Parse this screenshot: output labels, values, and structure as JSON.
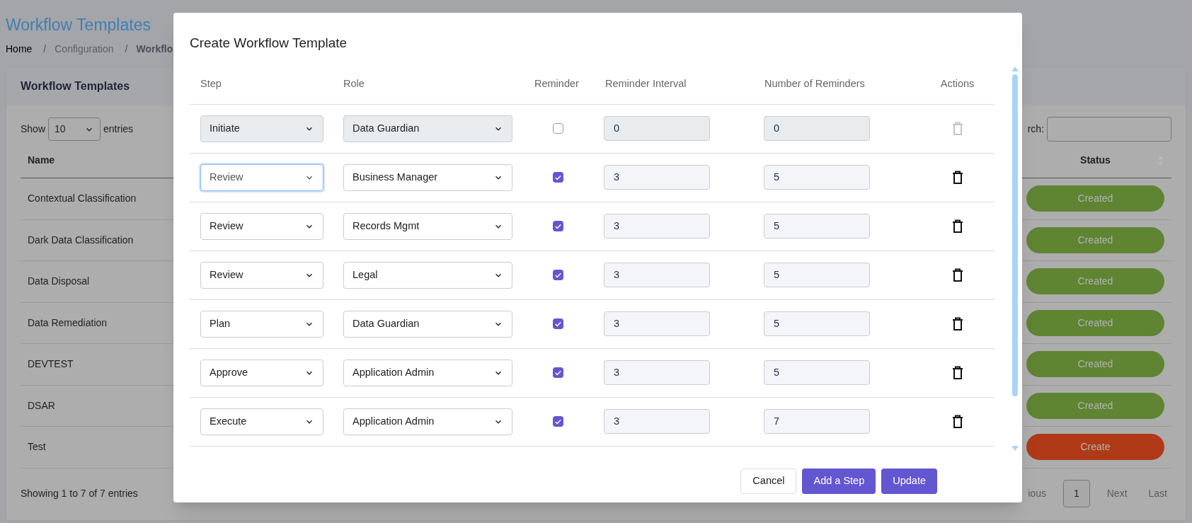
{
  "page": {
    "title": "Workflow Templates",
    "breadcrumb": [
      {
        "label": "Home",
        "current": false
      },
      {
        "separator": "/",
        "label": "Configuration",
        "current": false
      },
      {
        "separator": "/",
        "label": "Workflo",
        "current": true
      }
    ]
  },
  "card": {
    "title": "Workflow Templates",
    "show_label": "Show",
    "page_size": "10",
    "entries_label": "entries",
    "search_label": "rch:",
    "columns": [
      "Name",
      "Status"
    ],
    "rows": [
      {
        "name": "Contextual Classification",
        "status": "Created",
        "color": "#5f8432"
      },
      {
        "name": "Dark Data Classification",
        "status": "Created",
        "color": "#5f8432"
      },
      {
        "name": "Data Disposal",
        "status": "Created",
        "color": "#5f8432"
      },
      {
        "name": "Data Remediation",
        "status": "Created",
        "color": "#5f8432"
      },
      {
        "name": "DEVTEST",
        "status": "Created",
        "color": "#5f8432"
      },
      {
        "name": "DSAR",
        "status": "Created",
        "color": "#5f8432"
      },
      {
        "name": "Test",
        "status": "Create",
        "color": "#b03a18"
      }
    ],
    "info": "Showing 1 to 7 of 7 entries",
    "pagination": [
      {
        "label": "ious",
        "selected": false
      },
      {
        "label": "1",
        "selected": true
      },
      {
        "label": "Next",
        "selected": false
      },
      {
        "label": "Last",
        "selected": false
      }
    ]
  },
  "dialog": {
    "title": "Create Workflow Template",
    "columns": [
      "Step",
      "Role",
      "Reminder",
      "Reminder Interval",
      "Number of Reminders",
      "Actions"
    ],
    "steps": [
      {
        "step": "Initiate",
        "role": "Data Guardian",
        "reminder": false,
        "interval": "0",
        "count": "0",
        "disabled": true,
        "focused": false
      },
      {
        "step": "Review",
        "role": "Business Manager",
        "reminder": true,
        "interval": "3",
        "count": "5",
        "disabled": false,
        "focused": true
      },
      {
        "step": "Review",
        "role": "Records Mgmt",
        "reminder": true,
        "interval": "3",
        "count": "5",
        "disabled": false,
        "focused": false
      },
      {
        "step": "Review",
        "role": "Legal",
        "reminder": true,
        "interval": "3",
        "count": "5",
        "disabled": false,
        "focused": false
      },
      {
        "step": "Plan",
        "role": "Data Guardian",
        "reminder": true,
        "interval": "3",
        "count": "5",
        "disabled": false,
        "focused": false
      },
      {
        "step": "Approve",
        "role": "Application Admin",
        "reminder": true,
        "interval": "3",
        "count": "5",
        "disabled": false,
        "focused": false
      },
      {
        "step": "Execute",
        "role": "Application Admin",
        "reminder": true,
        "interval": "3",
        "count": "7",
        "disabled": false,
        "focused": false
      }
    ],
    "buttons": [
      {
        "label": "Cancel",
        "kind": "secondary"
      },
      {
        "label": "Add a Step",
        "kind": "primary"
      },
      {
        "label": "Update",
        "kind": "primary"
      }
    ]
  }
}
